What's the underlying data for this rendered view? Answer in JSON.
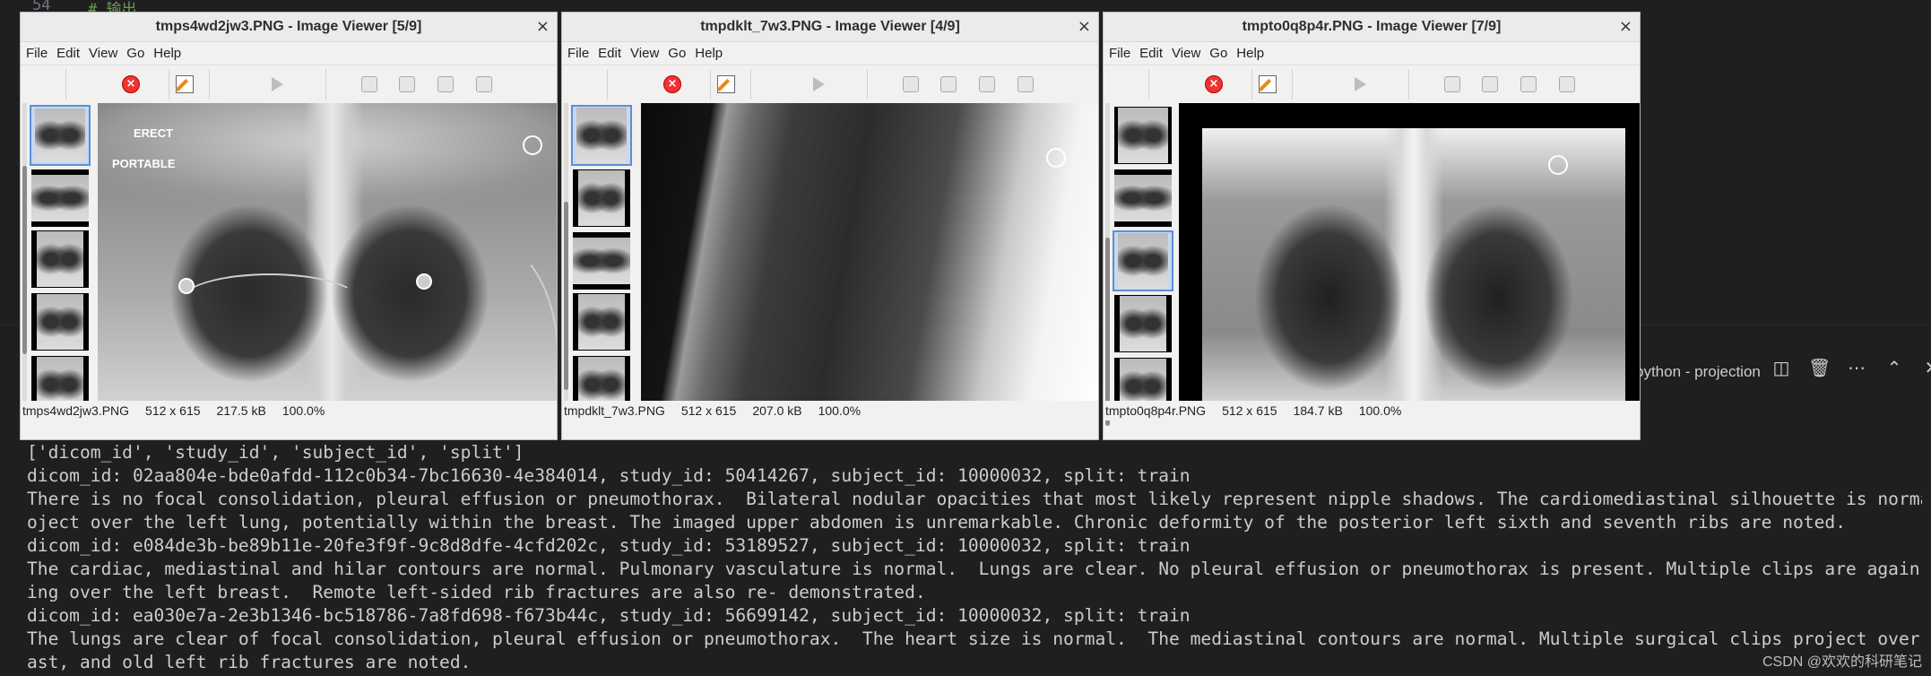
{
  "editor": {
    "line_number": "54",
    "line_code": "# 输出",
    "terminal_title": "python - projection",
    "terminal_actions": [
      "split-icon",
      "trash-icon",
      "more-icon",
      "chevron-up-icon",
      "close-icon"
    ]
  },
  "terminal_lines": [
    "['dicom_id', 'study_id', 'subject_id', 'split']",
    "dicom_id: 02aa804e-bde0afdd-112c0b34-7bc16630-4e384014, study_id: 50414267, subject_id: 10000032, split: train",
    "There is no focal consolidation, pleural effusion or pneumothorax.  Bilateral nodular opacities that most likely represent nipple shadows. The cardiomediastinal silhouette is normal.  Clips pr",
    "oject over the left lung, potentially within the breast. The imaged upper abdomen is unremarkable. Chronic deformity of the posterior left sixth and seventh ribs are noted.",
    "dicom_id: e084de3b-be89b11e-20fe3f9f-9c8d8dfe-4cfd202c, study_id: 53189527, subject_id: 10000032, split: train",
    "The cardiac, mediastinal and hilar contours are normal. Pulmonary vasculature is normal.  Lungs are clear. No pleural effusion or pneumothorax is present. Multiple clips are again seen project",
    "ing over the left breast.  Remote left-sided rib fractures are also re- demonstrated.",
    "dicom_id: ea030e7a-2e3b1346-bc518786-7a8fd698-f673b44c, study_id: 56699142, subject_id: 10000032, split: train",
    "The lungs are clear of focal consolidation, pleural effusion or pneumothorax.  The heart size is normal.  The mediastinal contours are normal. Multiple surgical clips project over the left bre",
    "ast, and old left rib fractures are noted."
  ],
  "watermark": "CSDN @欢欢的科研笔记",
  "menu": [
    "File",
    "Edit",
    "View",
    "Go",
    "Help"
  ],
  "windows": [
    {
      "title": "tmps4wd2jw3.PNG - Image Viewer [5/9]",
      "filename": "tmps4wd2jw3.PNG",
      "dims": "512 x 615",
      "size": "217.5 kB",
      "zoom": "100.0%",
      "overlay_erect": "ERECT",
      "overlay_portable": "PORTABLE"
    },
    {
      "title": "tmpdklt_7w3.PNG - Image Viewer [4/9]",
      "filename": "tmpdklt_7w3.PNG",
      "dims": "512 x 615",
      "size": "207.0 kB",
      "zoom": "100.0%"
    },
    {
      "title": "tmpto0q8p4r.PNG - Image Viewer [7/9]",
      "filename": "tmpto0q8p4r.PNG",
      "dims": "512 x 615",
      "size": "184.7 kB",
      "zoom": "100.0%"
    }
  ],
  "close_glyph": "×"
}
